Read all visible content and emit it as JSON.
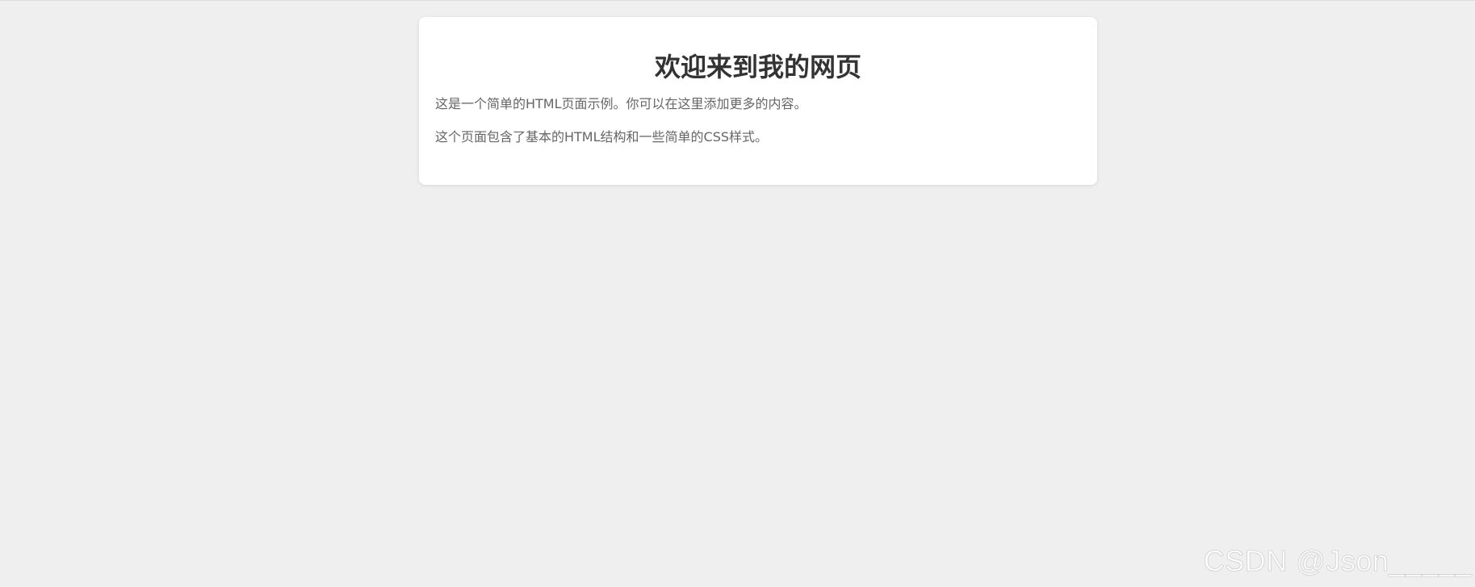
{
  "page": {
    "title": "欢迎来到我的网页",
    "paragraphs": [
      "这是一个简单的HTML页面示例。你可以在这里添加更多的内容。",
      "这个页面包含了基本的HTML结构和一些简单的CSS样式。"
    ]
  },
  "watermark": "CSDN @Json_____",
  "colors": {
    "background": "#efefef",
    "card": "#ffffff",
    "title": "#333333",
    "text": "#666666"
  }
}
